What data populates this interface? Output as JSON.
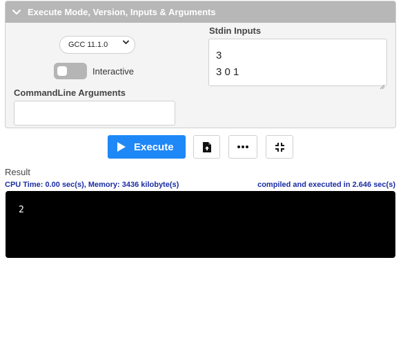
{
  "panel": {
    "header_title": "Execute Mode, Version, Inputs & Arguments",
    "version": "GCC 11.1.0",
    "interactive_label": "Interactive",
    "interactive_on": false,
    "cmd_label": "CommandLine Arguments",
    "cmd_value": "",
    "stdin_label": "Stdin Inputs",
    "stdin_lines": [
      "3",
      "3 0 1"
    ]
  },
  "toolbar": {
    "execute_label": "Execute",
    "accent": "#1e88f7"
  },
  "result": {
    "label": "Result",
    "stats": "CPU Time: 0.00 sec(s), Memory: 3436 kilobyte(s)",
    "compile_info": "compiled and executed in 2.646 sec(s)",
    "output": "2",
    "stats_color": "#1a2da3"
  }
}
